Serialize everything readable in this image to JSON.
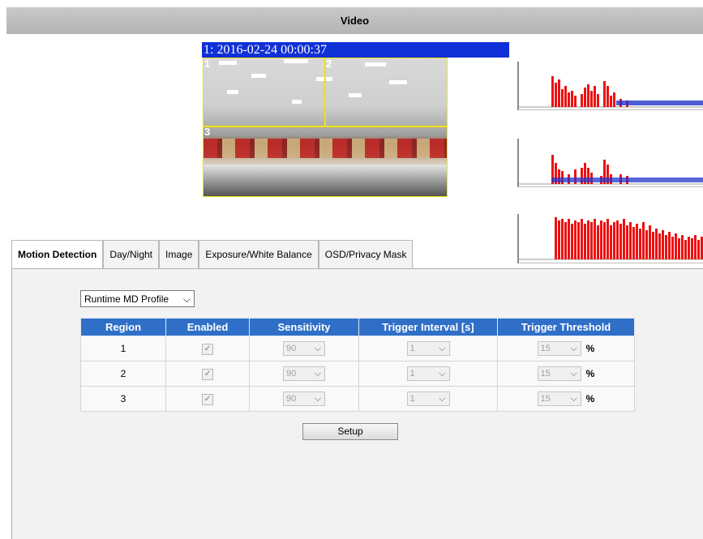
{
  "header": {
    "title": "Video"
  },
  "video": {
    "timestamp": "1: 2016-02-24 00:00:37",
    "regions": [
      "1",
      "2",
      "3"
    ]
  },
  "tabs": [
    {
      "label": "Motion Detection",
      "active": true
    },
    {
      "label": "Day/Night",
      "active": false
    },
    {
      "label": "Image",
      "active": false
    },
    {
      "label": "Exposure/White Balance",
      "active": false
    },
    {
      "label": "OSD/Privacy Mask",
      "active": false
    }
  ],
  "motion": {
    "profile": "Runtime MD Profile",
    "columns": [
      "Region",
      "Enabled",
      "Sensitivity",
      "Trigger Interval [s]",
      "Trigger Threshold"
    ],
    "rows": [
      {
        "region": "1",
        "enabled": true,
        "sensitivity": "90",
        "interval": "1",
        "threshold": "15",
        "unit": "%"
      },
      {
        "region": "2",
        "enabled": true,
        "sensitivity": "90",
        "interval": "1",
        "threshold": "15",
        "unit": "%"
      },
      {
        "region": "3",
        "enabled": true,
        "sensitivity": "90",
        "interval": "1",
        "threshold": "15",
        "unit": "%"
      }
    ],
    "setup_label": "Setup"
  },
  "colors": {
    "header_bg": "#c0c0c0",
    "table_header": "#2f6fc8",
    "timestamp_bg": "#1030d8",
    "region_border": "#f2e400",
    "graph_motion": "#ee1111",
    "graph_level": "#2233cc"
  },
  "icons": {
    "checkbox": "check-icon",
    "dropdown": "chevron-down-icon"
  }
}
